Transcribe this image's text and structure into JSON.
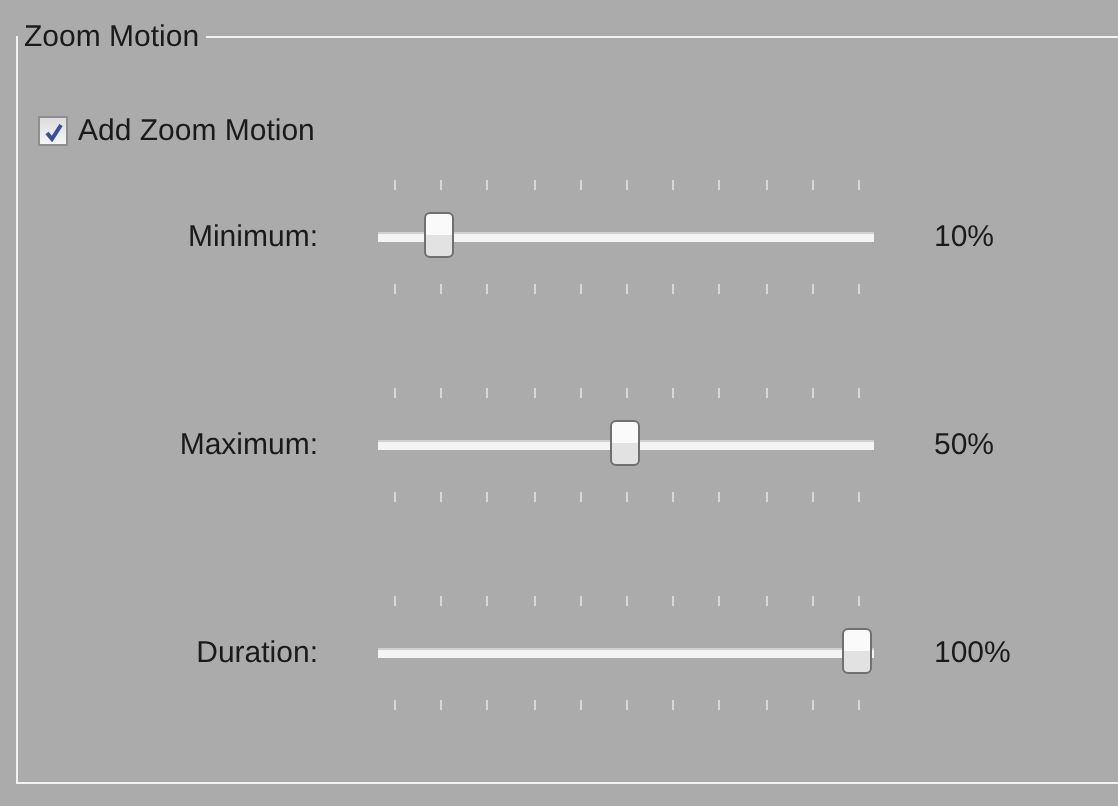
{
  "group": {
    "title": "Zoom Motion"
  },
  "checkbox": {
    "label": "Add Zoom Motion",
    "checked": true
  },
  "sliders": [
    {
      "label": "Minimum:",
      "level": 0.1,
      "reading": "10%"
    },
    {
      "label": "Maximum:",
      "level": 0.5,
      "reading": "50%"
    },
    {
      "label": "Duration:",
      "level": 1.0,
      "reading": "100%"
    }
  ]
}
